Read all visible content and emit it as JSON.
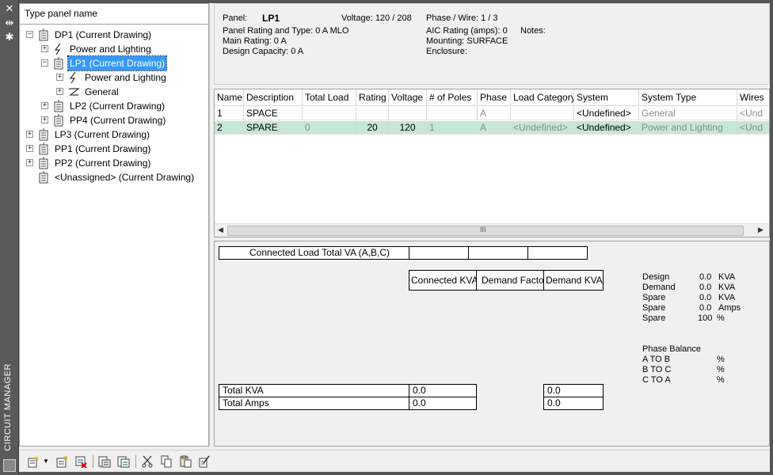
{
  "window": {
    "title": "CIRCUIT MANAGER",
    "close_glyph": "✕",
    "pin_glyph": "⇹",
    "settings_glyph": "✱"
  },
  "search": {
    "placeholder": "Type panel name"
  },
  "tree": {
    "nodes": [
      {
        "label": "DP1 (Current Drawing)"
      },
      {
        "label": "Power and Lighting"
      },
      {
        "label": "LP1 (Current Drawing)"
      },
      {
        "label": "Power and Lighting"
      },
      {
        "label": "General"
      },
      {
        "label": "LP2 (Current Drawing)"
      },
      {
        "label": "PP4 (Current Drawing)"
      },
      {
        "label": "LP3 (Current Drawing)"
      },
      {
        "label": "PP1 (Current Drawing)"
      },
      {
        "label": "PP2 (Current Drawing)"
      },
      {
        "label": "<Unassigned> (Current Drawing)"
      }
    ]
  },
  "panel_info": {
    "panel_label": "Panel:",
    "panel_name": "LP1",
    "voltage": "Voltage: 120 / 208",
    "phase_wire": "Phase / Wire:  1 /  3",
    "rating_type": "Panel Rating and Type: 0 A MLO",
    "aic": "AIC Rating (amps):  0",
    "notes": "Notes:",
    "main_rating": "Main Rating: 0 A",
    "mounting": "Mounting: SURFACE",
    "design_capacity": "Design Capacity: 0 A",
    "enclosure": "Enclosure:"
  },
  "grid": {
    "headers": [
      "Name",
      "Description",
      "Total Load",
      "Rating",
      "Voltage",
      "# of Poles",
      "Phase",
      "Load Category",
      "System",
      "System Type",
      "Wires"
    ],
    "rows": [
      {
        "name": "1",
        "description": "SPACE",
        "total_load": "",
        "rating": "",
        "voltage": "",
        "poles": "",
        "phase": "A",
        "load_category": "",
        "system": "<Undefined>",
        "system_type": "General",
        "wires": "<Und"
      },
      {
        "name": "2",
        "description": "SPARE",
        "total_load": "0",
        "rating": "20",
        "voltage": "120",
        "poles": "1",
        "phase": "A",
        "load_category": "<Undefined>",
        "system": "<Undefined>",
        "system_type": "Power and Lighting",
        "wires": "<Und"
      }
    ],
    "scroll_glyph": "III"
  },
  "summary": {
    "connected_load_label": "Connected Load Total VA (A,B,C)",
    "col_connected_kva": "Connected KVA",
    "col_demand_factor": "Demand Factor",
    "col_demand_kva": "Demand KVA",
    "total_kva_label": "Total KVA",
    "total_amps_label": "Total Amps",
    "total_kva_connected": "0.0",
    "total_kva_demand": "0.0",
    "total_amps_connected": "0.0",
    "total_amps_demand": "0.0",
    "stats": [
      {
        "label": "Design",
        "value": "0.0",
        "unit": "KVA"
      },
      {
        "label": "Demand",
        "value": "0.0",
        "unit": "KVA"
      },
      {
        "label": "Spare",
        "value": "0.0",
        "unit": "KVA"
      },
      {
        "label": "Spare",
        "value": "0.0",
        "unit": "Amps"
      },
      {
        "label": "Spare",
        "value": "100",
        "unit": "%"
      }
    ],
    "phase_balance_title": "Phase Balance",
    "phase_balance": [
      {
        "label": "A TO B",
        "unit": "%"
      },
      {
        "label": "B TO C",
        "unit": "%"
      },
      {
        "label": "C TO A",
        "unit": "%"
      }
    ]
  },
  "colors": {
    "selection": "#3399ff",
    "row_selected": "#c6e7d3",
    "panel_bg": "#f0f0f0"
  }
}
